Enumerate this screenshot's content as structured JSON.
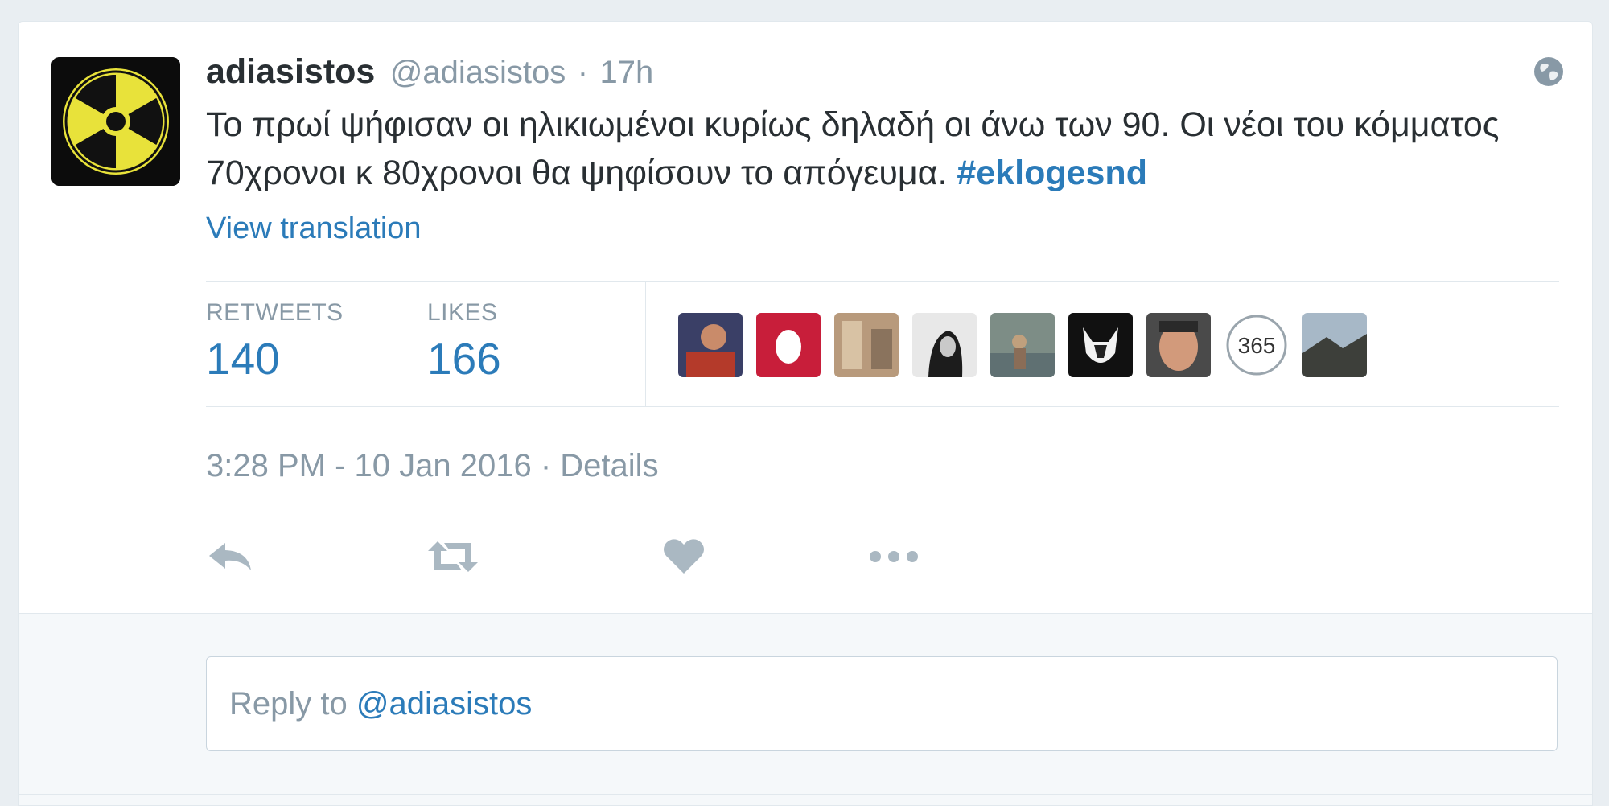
{
  "tweet": {
    "fullname": "adiasistos",
    "username": "@adiasistos",
    "separator": "·",
    "time_ago": "17h",
    "text": "Το πρωί ψήφισαν οι ηλικιωμένοι κυρίως δηλαδή οι άνω των 90. Οι νέοι του κόμματος 70χρονοι κ 80χρονοι θα ψηφίσουν το απόγευμα.",
    "hashtag": "#eklogesnd",
    "view_translation": "View translation",
    "globe_icon": "globe-icon",
    "avatar_icon": "radiation-symbol-icon"
  },
  "stats": {
    "retweets_label": "RETWEETS",
    "retweets_value": "140",
    "likes_label": "LIKES",
    "likes_value": "166",
    "liker_avatars": [
      "avatar-1",
      "avatar-2",
      "avatar-3",
      "avatar-4",
      "avatar-5",
      "avatar-6",
      "avatar-7",
      "avatar-8",
      "avatar-9"
    ],
    "avatar_8_text": "365"
  },
  "meta": {
    "timestamp": "3:28 PM - 10 Jan 2016",
    "separator": "·",
    "details": "Details"
  },
  "actions": {
    "reply_icon": "reply-icon",
    "retweet_icon": "retweet-icon",
    "like_icon": "heart-icon",
    "more_icon": "more-dots-icon"
  },
  "reply": {
    "prefix": "Reply to",
    "mention": "@adiasistos"
  },
  "colors": {
    "link": "#2b7bb9",
    "muted": "#8899a6",
    "text": "#292f33",
    "page_bg": "#e9eef2"
  }
}
